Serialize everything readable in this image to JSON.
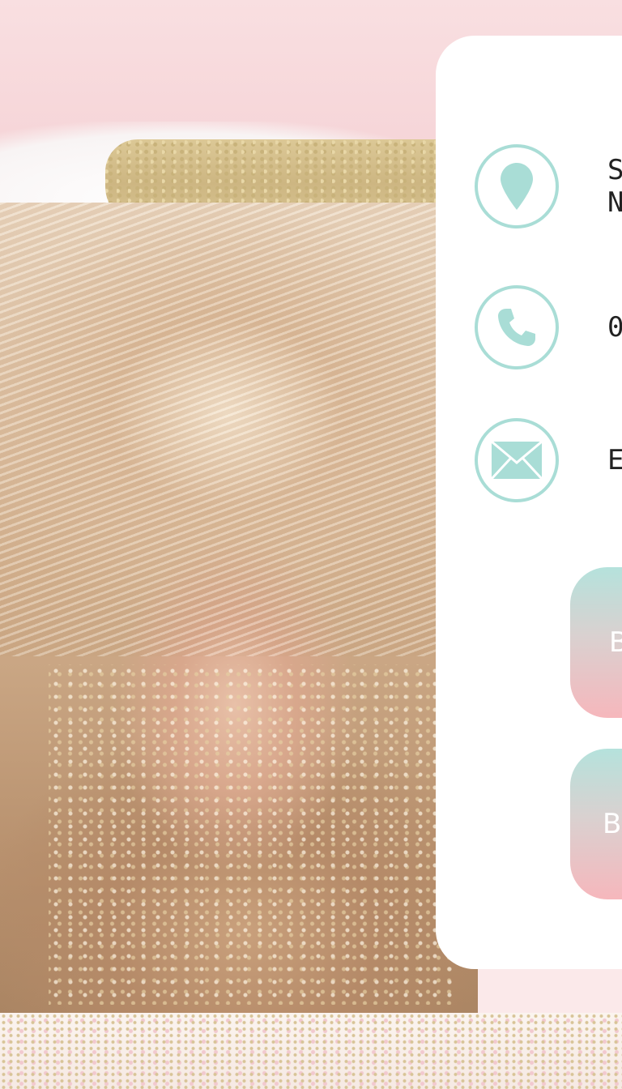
{
  "colors": {
    "accent_teal": "#a9ddd6",
    "accent_pink": "#f6b7bc",
    "background_pink": "#f9dfe1",
    "card_white": "#ffffff",
    "text_dark": "#222222"
  },
  "contact": {
    "address": {
      "icon": "map-pin-icon",
      "line1": "S",
      "line2": "N"
    },
    "phone": {
      "icon": "phone-icon",
      "text": "0"
    },
    "email": {
      "icon": "envelope-icon",
      "text": "E"
    }
  },
  "buttons": [
    {
      "label": "B"
    },
    {
      "label": "B"
    }
  ]
}
